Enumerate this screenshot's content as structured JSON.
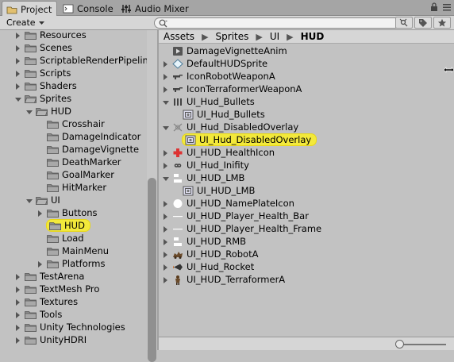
{
  "tabs": [
    {
      "label": "Project",
      "icon": "folder-icon"
    },
    {
      "label": "Console",
      "icon": "console-icon"
    },
    {
      "label": "Audio Mixer",
      "icon": "audio-mixer-icon"
    }
  ],
  "toolbar": {
    "create_label": "Create",
    "search_placeholder": ""
  },
  "tree": [
    {
      "label": "Resources",
      "depth": 1,
      "arrow": "right"
    },
    {
      "label": "Scenes",
      "depth": 1,
      "arrow": "right"
    },
    {
      "label": "ScriptableRenderPipelin",
      "depth": 1,
      "arrow": "right"
    },
    {
      "label": "Scripts",
      "depth": 1,
      "arrow": "right"
    },
    {
      "label": "Shaders",
      "depth": 1,
      "arrow": "right"
    },
    {
      "label": "Sprites",
      "depth": 1,
      "arrow": "down"
    },
    {
      "label": "HUD",
      "depth": 2,
      "arrow": "down"
    },
    {
      "label": "Crosshair",
      "depth": 3,
      "arrow": "none"
    },
    {
      "label": "DamageIndicator",
      "depth": 3,
      "arrow": "none"
    },
    {
      "label": "DamageVignette",
      "depth": 3,
      "arrow": "none"
    },
    {
      "label": "DeathMarker",
      "depth": 3,
      "arrow": "none"
    },
    {
      "label": "GoalMarker",
      "depth": 3,
      "arrow": "none"
    },
    {
      "label": "HitMarker",
      "depth": 3,
      "arrow": "none"
    },
    {
      "label": "UI",
      "depth": 2,
      "arrow": "down"
    },
    {
      "label": "Buttons",
      "depth": 3,
      "arrow": "right"
    },
    {
      "label": "HUD",
      "depth": 3,
      "arrow": "none",
      "selected": true
    },
    {
      "label": "Load",
      "depth": 3,
      "arrow": "none"
    },
    {
      "label": "MainMenu",
      "depth": 3,
      "arrow": "none"
    },
    {
      "label": "Platforms",
      "depth": 3,
      "arrow": "right"
    },
    {
      "label": "TestArena",
      "depth": 1,
      "arrow": "right"
    },
    {
      "label": "TextMesh Pro",
      "depth": 1,
      "arrow": "right"
    },
    {
      "label": "Textures",
      "depth": 1,
      "arrow": "right"
    },
    {
      "label": "Tools",
      "depth": 1,
      "arrow": "right"
    },
    {
      "label": "Unity Technologies",
      "depth": 1,
      "arrow": "right"
    },
    {
      "label": "UnityHDRI",
      "depth": 1,
      "arrow": "right"
    }
  ],
  "breadcrumb": [
    "Assets",
    "Sprites",
    "UI",
    "HUD"
  ],
  "assets": [
    {
      "label": "DamageVignetteAnim",
      "depth": 0,
      "arrow": "none",
      "icon": "animation-clip-icon"
    },
    {
      "label": "DefaultHUDSprite",
      "depth": 0,
      "arrow": "right",
      "icon": "sprite-diamond-icon"
    },
    {
      "label": "IconRobotWeaponA",
      "depth": 0,
      "arrow": "right",
      "icon": "weapon-sprite-icon"
    },
    {
      "label": "IconTerraformerWeaponA",
      "depth": 0,
      "arrow": "right",
      "icon": "weapon-sprite-icon"
    },
    {
      "label": "UI_Hud_Bullets",
      "depth": 0,
      "arrow": "down",
      "icon": "bullets-sprite-icon"
    },
    {
      "label": "UI_Hud_Bullets",
      "depth": 1,
      "arrow": "none",
      "icon": "sprite-asset-icon"
    },
    {
      "label": "UI_Hud_DisabledOverlay",
      "depth": 0,
      "arrow": "down",
      "icon": "overlay-sprite-icon"
    },
    {
      "label": "UI_Hud_DisabledOverlay",
      "depth": 1,
      "arrow": "none",
      "icon": "sprite-asset-icon",
      "selected": true
    },
    {
      "label": "UI_HUD_HealthIcon",
      "depth": 0,
      "arrow": "right",
      "icon": "health-cross-icon"
    },
    {
      "label": "UI_Hud_Inifity",
      "depth": 0,
      "arrow": "right",
      "icon": "infinity-icon"
    },
    {
      "label": "UI_HUD_LMB",
      "depth": 0,
      "arrow": "down",
      "icon": "mouse-button-icon"
    },
    {
      "label": "UI_HUD_LMB",
      "depth": 1,
      "arrow": "none",
      "icon": "sprite-asset-icon"
    },
    {
      "label": "UI_HUD_NamePlateIcon",
      "depth": 0,
      "arrow": "right",
      "icon": "nameplate-circle-icon"
    },
    {
      "label": "UI_HUD_Player_Health_Bar",
      "depth": 0,
      "arrow": "right",
      "icon": "health-bar-icon"
    },
    {
      "label": "UI_HUD_Player_Health_Frame",
      "depth": 0,
      "arrow": "right",
      "icon": "health-frame-icon"
    },
    {
      "label": "UI_HUD_RMB",
      "depth": 0,
      "arrow": "right",
      "icon": "mouse-button-icon"
    },
    {
      "label": "UI_HUD_RobotA",
      "depth": 0,
      "arrow": "right",
      "icon": "robot-sprite-icon"
    },
    {
      "label": "UI_Hud_Rocket",
      "depth": 0,
      "arrow": "right",
      "icon": "rocket-sprite-icon"
    },
    {
      "label": "UI_HUD_TerraformerA",
      "depth": 0,
      "arrow": "right",
      "icon": "terraformer-sprite-icon"
    }
  ],
  "colors": {
    "selection": "#f3e93b",
    "panel": "#c2c2c2",
    "toolbar": "#d6d6d6"
  }
}
